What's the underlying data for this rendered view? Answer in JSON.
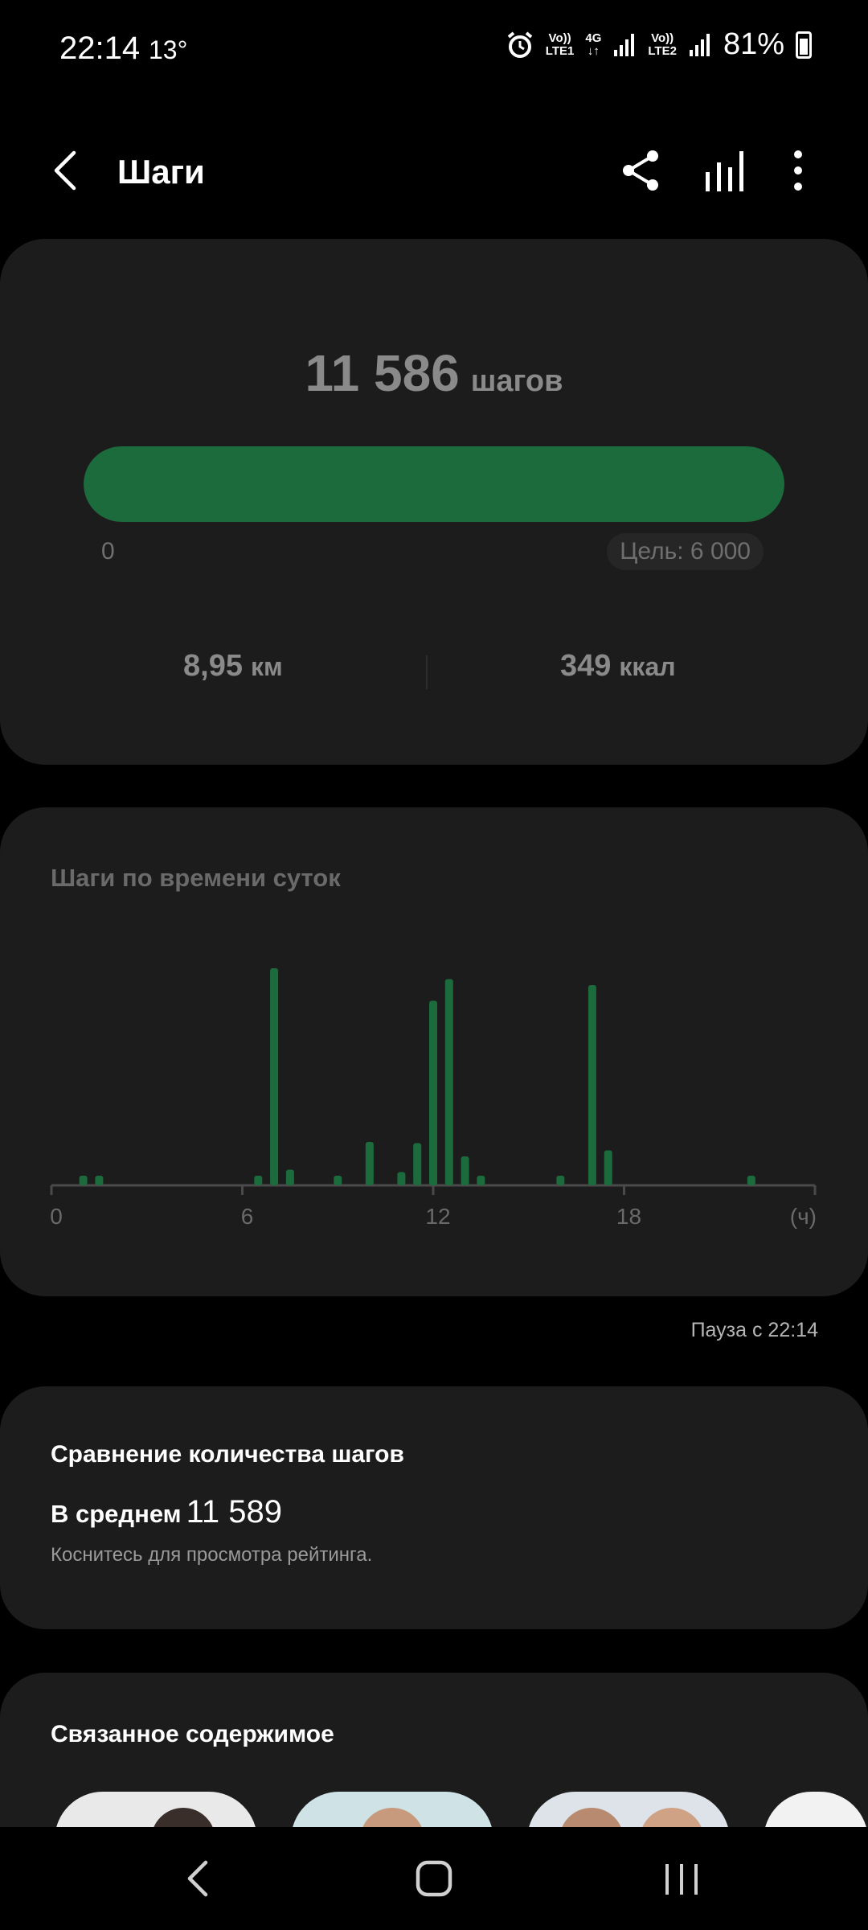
{
  "status_bar": {
    "time": "22:14",
    "temperature": "13°",
    "sim1_top": "Vo))",
    "sim1_bottom": "LTE1",
    "net_type": "4G",
    "sim2_top": "Vo))",
    "sim2_bottom": "LTE2",
    "battery": "81%"
  },
  "header": {
    "title": "Шаги",
    "icons": [
      "back-icon",
      "share-icon",
      "stats-icon",
      "more-icon"
    ]
  },
  "summary": {
    "steps": "11 586",
    "steps_unit": "шагов",
    "progress_fraction": 1.0,
    "progress_min": "0",
    "goal": "Цель: 6 000",
    "distance_value": "8,95",
    "distance_unit": "км",
    "calories_value": "349",
    "calories_unit": "ккал"
  },
  "hourly_chart": {
    "title": "Шаги по времени суток",
    "pause_text": "Пауза с 22:14"
  },
  "chart_data": {
    "type": "bar",
    "title": "Шаги по времени суток",
    "x_ticks": [
      "0",
      "6",
      "12",
      "18",
      "(ч)"
    ],
    "xlim": [
      0,
      24
    ],
    "ylim": [
      0,
      1800
    ],
    "bar_color": "#1c6b3c",
    "x": [
      1.0,
      1.5,
      6.5,
      7.0,
      7.5,
      9.0,
      10.0,
      11.0,
      11.5,
      12.0,
      12.5,
      13.0,
      13.5,
      16.0,
      17.0,
      17.5,
      22.0
    ],
    "values": [
      80,
      80,
      80,
      1800,
      130,
      80,
      360,
      110,
      350,
      1530,
      1710,
      240,
      80,
      80,
      1660,
      290,
      80
    ]
  },
  "comparison": {
    "title": "Сравнение количества шагов",
    "avg_label": "В среднем",
    "avg_value": "11 589",
    "hint": "Коснитесь для просмотра рейтинга."
  },
  "related": {
    "title": "Связанное содержимое"
  },
  "colors": {
    "accent_green": "#1c6b3c",
    "card_bg": "#1c1c1c",
    "screen_bg": "#000000"
  }
}
